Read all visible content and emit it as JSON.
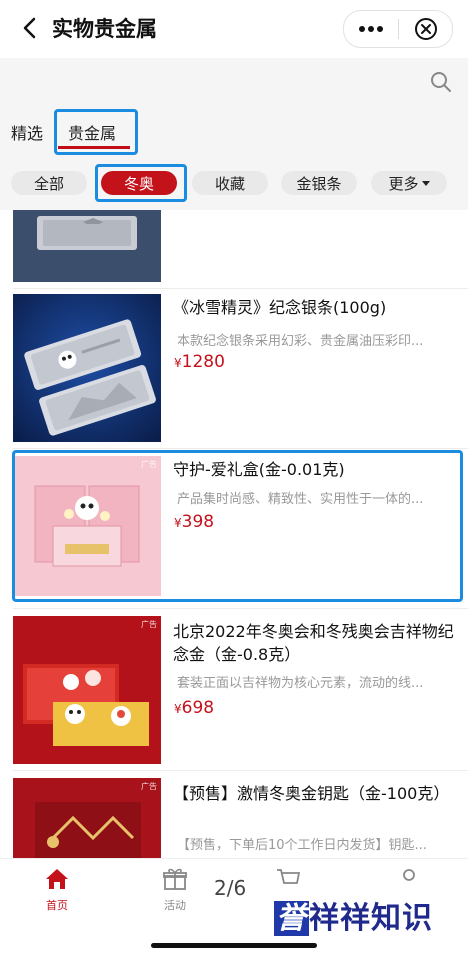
{
  "header": {
    "title": "实物贵金属"
  },
  "tabs": [
    {
      "label": "精选"
    },
    {
      "label": "贵金属"
    }
  ],
  "chips": [
    "全部",
    "冬奥",
    "收藏",
    "金银条",
    "更多"
  ],
  "products": [
    {
      "ad": "",
      "name": "《冰雪精灵》纪念银条(100g)",
      "desc": "本款纪念银条采用幻彩、贵金属油压彩印...",
      "price": "1280",
      "currency": "¥"
    },
    {
      "ad": "广告",
      "name": "守护-爱礼盒(金-0.01克)",
      "desc": "产品集时尚感、精致性、实用性于一体的...",
      "price": "398",
      "currency": "¥"
    },
    {
      "ad": "广告",
      "name": "北京2022年冬奥会和冬残奥会吉祥物纪念金（金-0.8克）",
      "desc": "套装正面以吉祥物为核心元素，流动的线...",
      "price": "698",
      "currency": "¥"
    },
    {
      "ad": "广告",
      "name": "【预售】激情冬奥金钥匙（金-100克）",
      "desc": "【预售，下单后10个工作日内发货】钥匙...",
      "price": "",
      "currency": "¥"
    }
  ],
  "bottom_nav": {
    "home_label": "首页",
    "activity_label": "活动",
    "page_indicator": "2/6"
  },
  "watermark": {
    "text_a": "誉",
    "text_b": "祥祥知识"
  },
  "colors": {
    "accent": "#c4121b",
    "highlight": "#1a8de0"
  }
}
